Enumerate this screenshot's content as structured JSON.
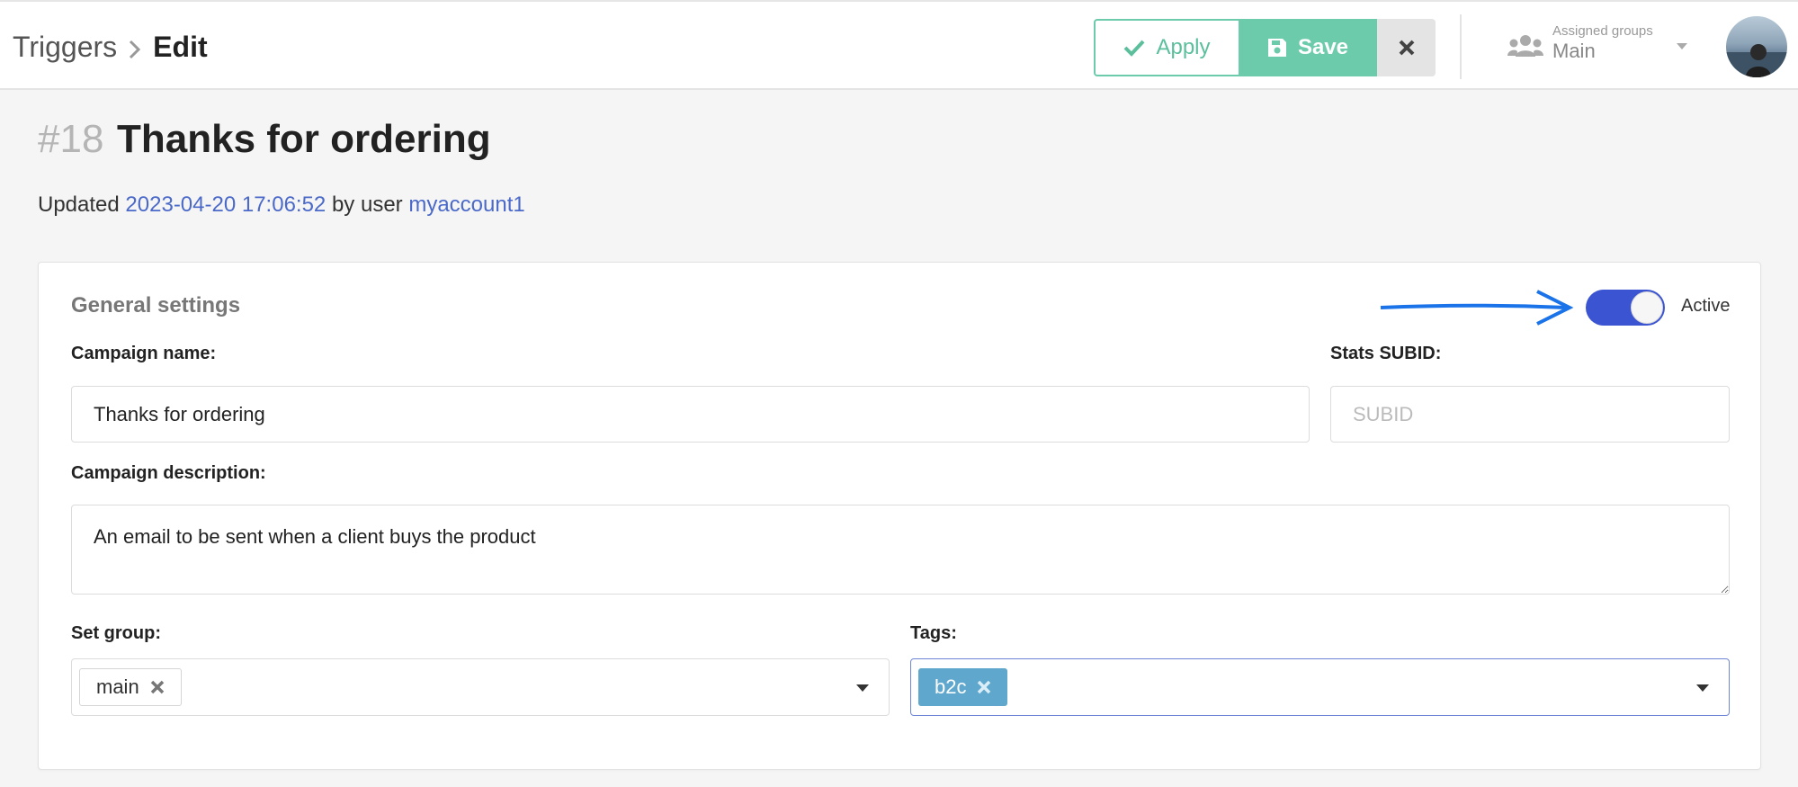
{
  "breadcrumb": {
    "root": "Triggers",
    "current": "Edit"
  },
  "toolbar": {
    "apply_label": "Apply",
    "save_label": "Save"
  },
  "assigned_groups": {
    "caption": "Assigned groups",
    "value": "Main"
  },
  "page": {
    "id": "#18",
    "title": "Thanks for ordering",
    "updated_prefix": "Updated",
    "updated_at": "2023-04-20 17:06:52",
    "by_user_text": "by user",
    "user": "myaccount1"
  },
  "general_settings": {
    "title": "General settings",
    "active_label": "Active",
    "active": true,
    "campaign_name_label": "Campaign name:",
    "campaign_name_value": "Thanks for ordering",
    "stats_subid_label": "Stats SUBID:",
    "stats_subid_placeholder": "SUBID",
    "campaign_description_label": "Campaign description:",
    "campaign_description_value": "An email to be sent when a client buys the product",
    "set_group_label": "Set group:",
    "set_group_selected": "main",
    "tags_label": "Tags:",
    "tags_selected": "b2c"
  },
  "colors": {
    "accent": "#6ccbaa",
    "toggle": "#3b54d1",
    "link": "#4a69c8",
    "tag": "#5fa7cc"
  }
}
